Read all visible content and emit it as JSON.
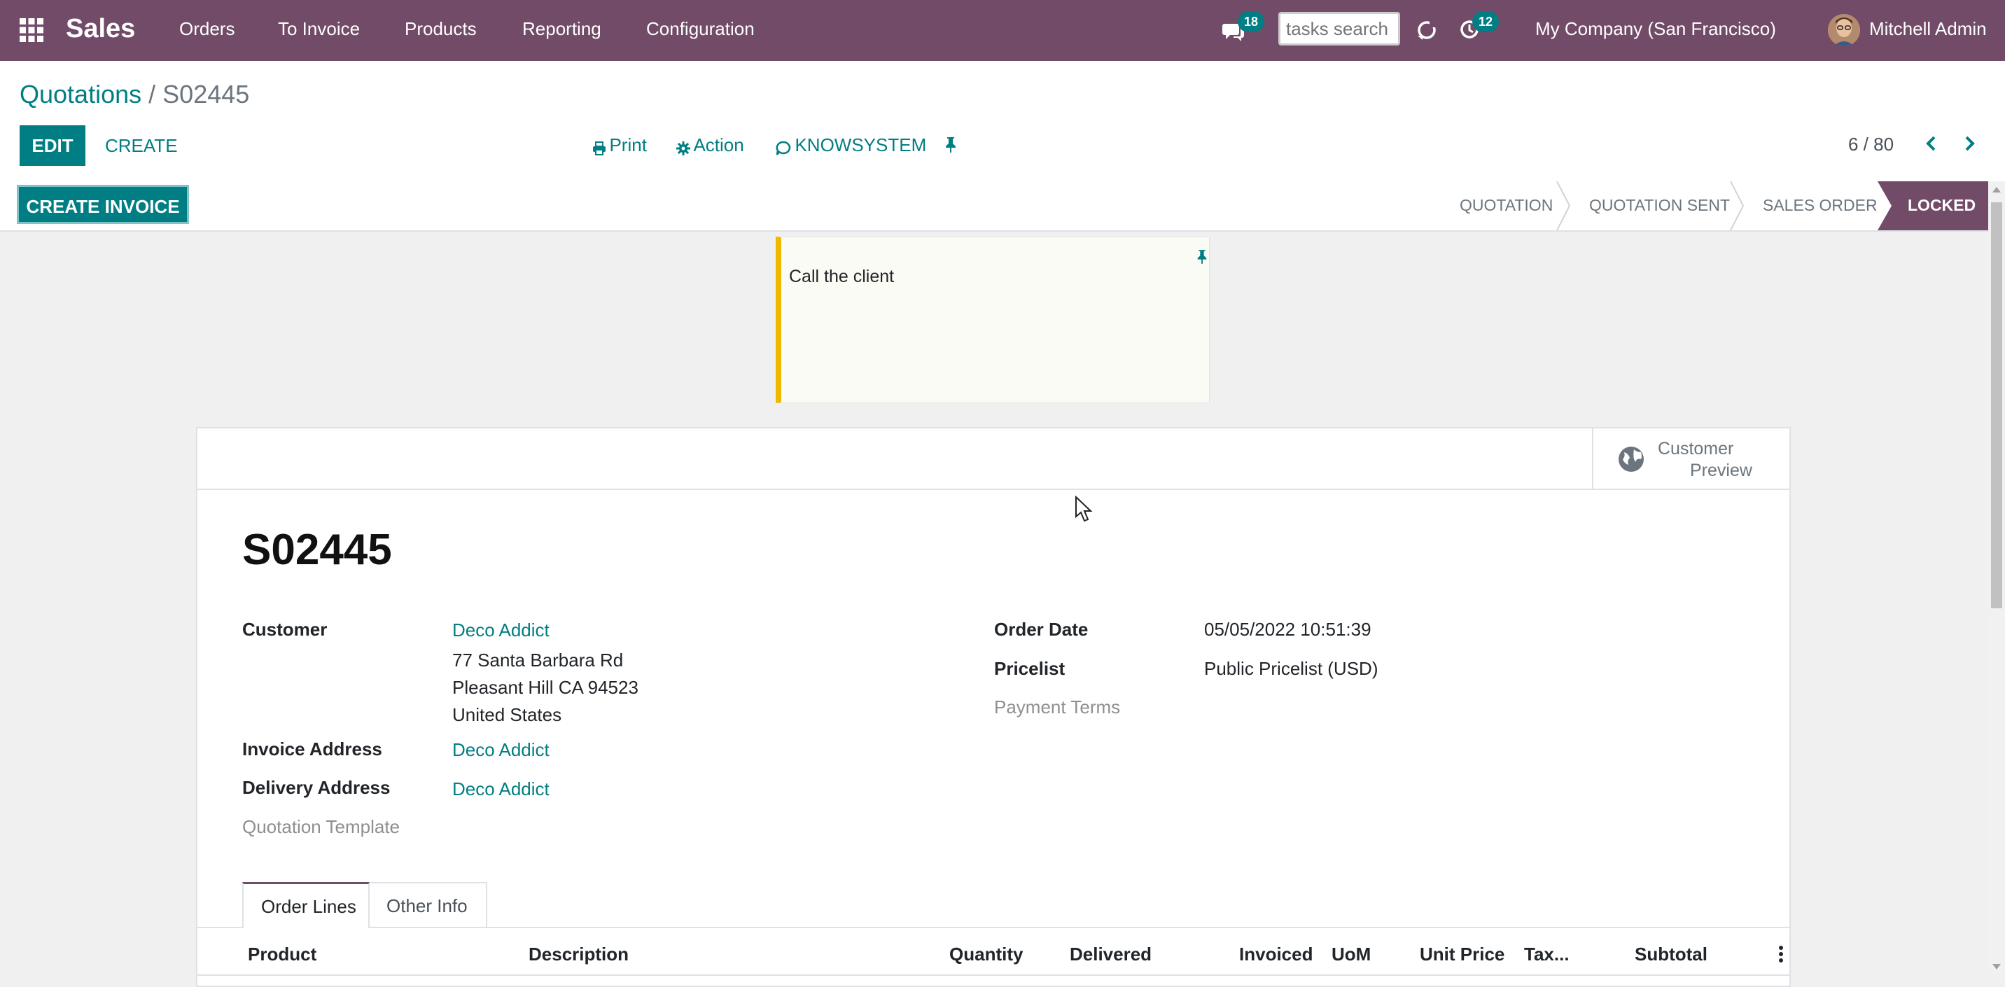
{
  "navbar": {
    "app_name": "Sales",
    "menu": [
      "Orders",
      "To Invoice",
      "Products",
      "Reporting",
      "Configuration"
    ],
    "messages_count": "18",
    "search_placeholder": "tasks search",
    "activities_count": "12",
    "company": "My Company (San Francisco)",
    "user": "Mitchell Admin"
  },
  "breadcrumb": {
    "parent": "Quotations",
    "separator": "/",
    "current": "S02445"
  },
  "toolbar": {
    "edit_label": "EDIT",
    "create_label": "CREATE",
    "print_label": "Print",
    "action_label": "Action",
    "knowsystem_label": "KNOWSYSTEM",
    "pager": "6 / 80"
  },
  "statusbar": {
    "create_invoice_label": "CREATE INVOICE",
    "stages": [
      "QUOTATION",
      "QUOTATION SENT",
      "SALES ORDER",
      "LOCKED"
    ],
    "active_stage": "LOCKED"
  },
  "note": {
    "text": "Call the client"
  },
  "smart_button": {
    "line1": "Customer",
    "line2": "Preview"
  },
  "record": {
    "name": "S02445",
    "customer_label": "Customer",
    "customer_name": "Deco Addict",
    "customer_address": [
      "77 Santa Barbara Rd",
      "Pleasant Hill CA 94523",
      "United States"
    ],
    "invoice_address_label": "Invoice Address",
    "invoice_address": "Deco Addict",
    "delivery_address_label": "Delivery Address",
    "delivery_address": "Deco Addict",
    "quotation_template_label": "Quotation Template",
    "order_date_label": "Order Date",
    "order_date": "05/05/2022 10:51:39",
    "pricelist_label": "Pricelist",
    "pricelist": "Public Pricelist (USD)",
    "payment_terms_label": "Payment Terms"
  },
  "tabs": [
    "Order Lines",
    "Other Info"
  ],
  "order_lines": {
    "columns": [
      "Product",
      "Description",
      "Quantity",
      "Delivered",
      "Invoiced",
      "UoM",
      "Unit Price",
      "Tax...",
      "Subtotal"
    ]
  },
  "colors": {
    "brand": "#714b67",
    "accent": "#017e84",
    "note_border": "#f0b800"
  },
  "icons": [
    "apps-grid-icon",
    "chat-icon",
    "refresh-icon",
    "clock-icon",
    "print-icon",
    "gear-icon",
    "knowsystem-icon",
    "pin-icon",
    "chevron-left-icon",
    "chevron-right-icon",
    "globe-icon",
    "kebab-icon",
    "cursor-icon"
  ]
}
